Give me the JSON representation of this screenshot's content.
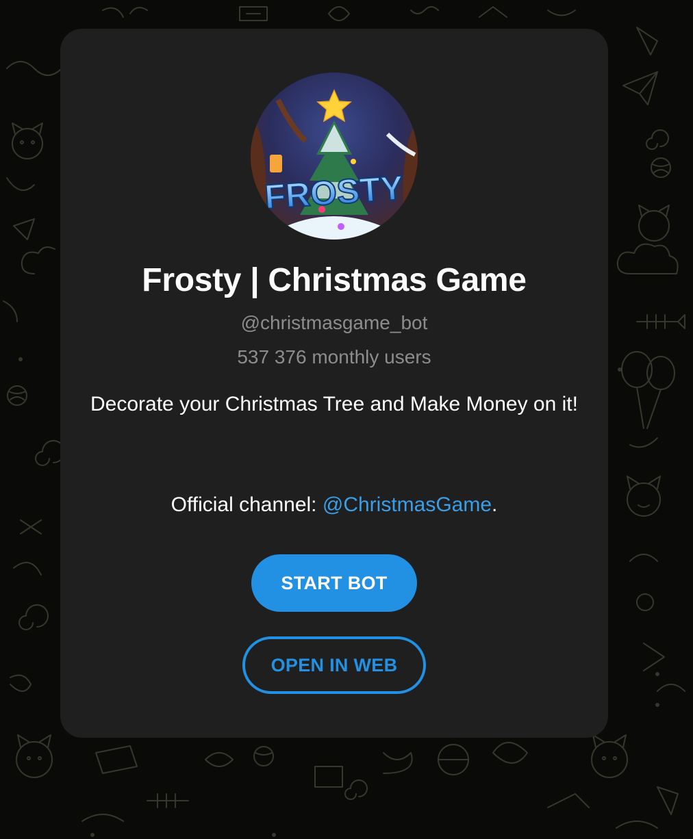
{
  "bot": {
    "name": "Frosty | Christmas Game",
    "username": "@christmasgame_bot",
    "monthly_users": "537 376 monthly users",
    "description": "Decorate your Christmas Tree and Make Money on it!",
    "channel_prefix": "Official channel: ",
    "channel_link": "@ChristmasGame",
    "channel_suffix": ".",
    "avatar_logo_text": "FROSTY"
  },
  "actions": {
    "start_label": "START BOT",
    "web_label": "OPEN IN WEB"
  },
  "colors": {
    "accent": "#2391e3",
    "link": "#3a9ee8",
    "card_background": "#1f1f1f",
    "page_background": "#0a0a09",
    "muted_text": "#8d8d8d"
  }
}
